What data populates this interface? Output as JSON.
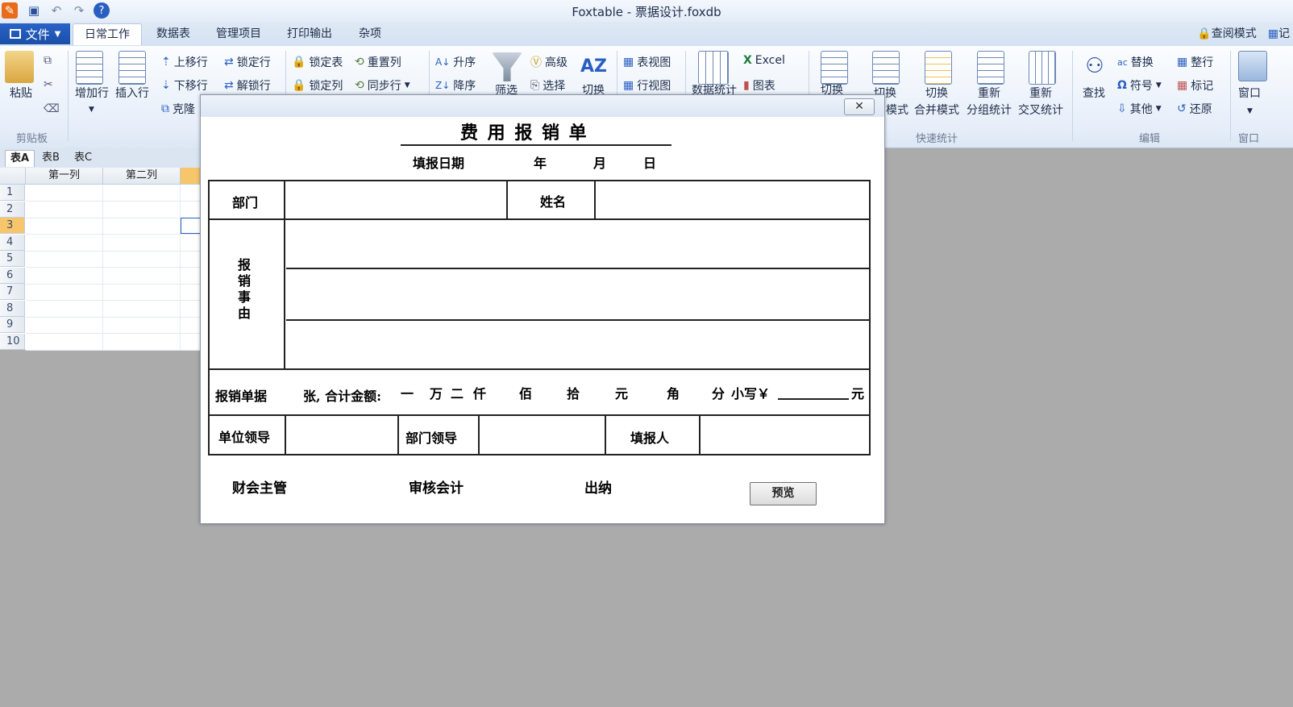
{
  "window": {
    "title": "Foxtable - 票据设计.foxdb"
  },
  "menu": {
    "file_label": "文件",
    "tabs": [
      "日常工作",
      "数据表",
      "管理项目",
      "打印输出",
      "杂项"
    ],
    "right": [
      "查阅模式",
      "记"
    ]
  },
  "ribbon": {
    "paste": "粘贴",
    "add_row": "增加行",
    "insert_row": "插入行",
    "move_up": "上移行",
    "move_down": "下移行",
    "clone": "克隆",
    "lock_row": "锁定行",
    "unlock_row": "解锁行",
    "lock_table": "锁定表",
    "lock_col": "锁定列",
    "reset_col": "重置列",
    "sync_row": "同步行",
    "asc": "升序",
    "desc": "降序",
    "filter": "筛选",
    "advanced": "高级",
    "select": "选择",
    "switch_sort": "切换",
    "table_view": "表视图",
    "row_view": "行视图",
    "data_stats": "数据统计",
    "excel": "Excel",
    "chart": "图表",
    "switch1": "切换",
    "switch2_l1": "切换",
    "switch2_l2": "模式",
    "merge_l1": "切换",
    "merge_l2": "合并模式",
    "regroup_l1": "重新",
    "regroup_l2": "分组统计",
    "recross_l1": "重新",
    "recross_l2": "交叉统计",
    "find": "查找",
    "replace": "替换",
    "symbol": "符号",
    "other": "其他",
    "whole_row": "整行",
    "mark": "标记",
    "restore": "还原",
    "window": "窗口",
    "groups": {
      "clipboard": "剪贴板",
      "quick_stats": "快速统计",
      "edit": "编辑",
      "window": "窗口"
    }
  },
  "sheet_tabs": [
    "表A",
    "表B",
    "表C"
  ],
  "grid": {
    "columns": [
      "第一列",
      "第二列"
    ],
    "rows": [
      "1",
      "2",
      "3",
      "4",
      "5",
      "6",
      "7",
      "8",
      "9",
      "10"
    ],
    "selected_row": "3"
  },
  "form": {
    "title": "费 用 报 销 单",
    "date_label": "填报日期",
    "year": "年",
    "month": "月",
    "day": "日",
    "dept": "部门",
    "name": "姓名",
    "reason": [
      "报",
      "销",
      "事",
      "由"
    ],
    "voucher": "报销单据",
    "amount_text": "张, 合计金额:",
    "amount_units": [
      "一",
      "万",
      "二",
      "仟",
      "佰",
      "拾",
      "元",
      "角",
      "分"
    ],
    "lowercase": "小写￥",
    "yuan_end": "元",
    "unit_leader": "单位领导",
    "dept_leader": "部门领导",
    "filler": "填报人",
    "finance_head": "财会主管",
    "auditor": "审核会计",
    "cashier": "出纳",
    "preview": "预览",
    "close": "✕"
  },
  "colors": {
    "ribbon_blue": "#1a4fa8",
    "workspace": "#ababab",
    "selected_row": "#f7c56a"
  }
}
